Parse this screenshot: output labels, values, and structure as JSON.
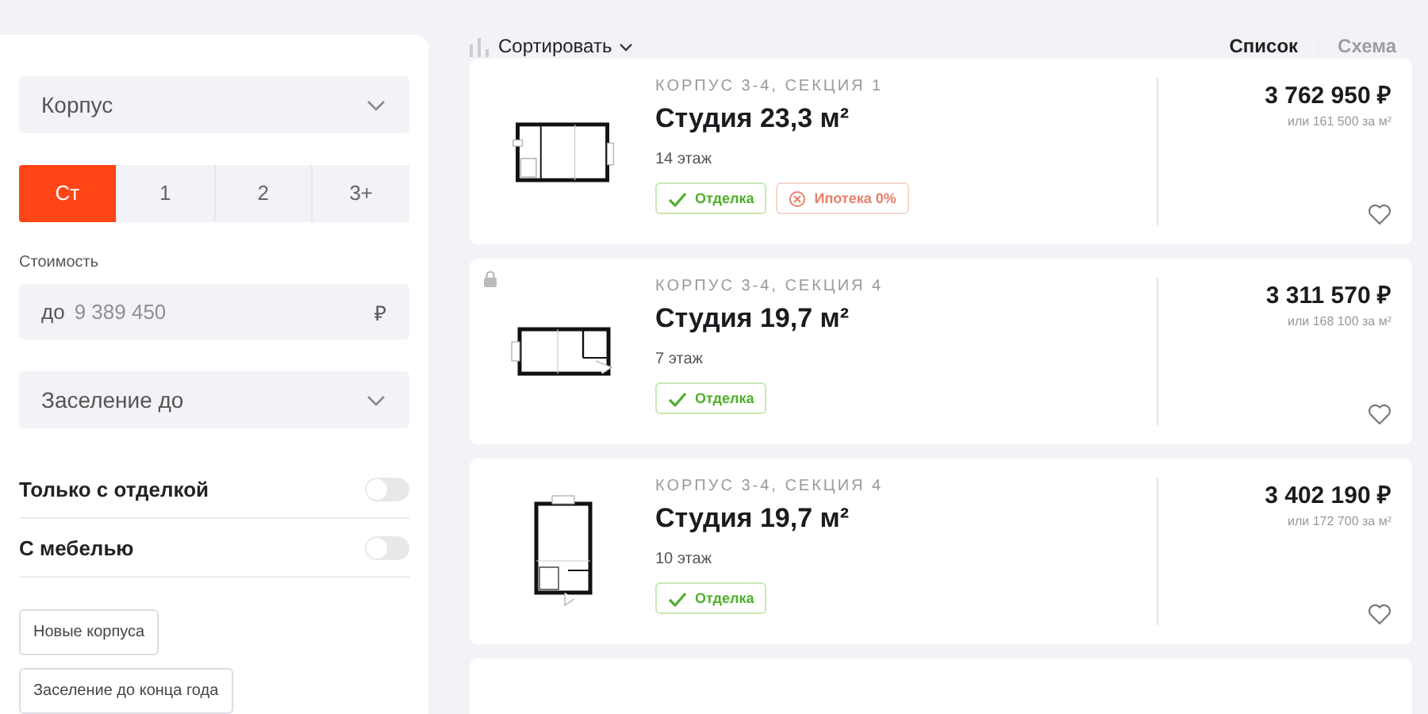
{
  "sidebar": {
    "building_select": {
      "placeholder": "Корпус"
    },
    "room_options": [
      {
        "label": "Ст",
        "selected": true
      },
      {
        "label": "1",
        "selected": false
      },
      {
        "label": "2",
        "selected": false
      },
      {
        "label": "3+",
        "selected": false
      }
    ],
    "price": {
      "label": "Стоимость",
      "prefix": "до",
      "placeholder": "9 389 450",
      "currency": "₽"
    },
    "move_in_select": {
      "placeholder": "Заселение до"
    },
    "toggles": [
      {
        "label": "Только с отделкой",
        "on": false
      },
      {
        "label": "С мебелью",
        "on": false
      }
    ],
    "chips": [
      "Новые корпуса",
      "Заселение до конца года"
    ]
  },
  "toolbar": {
    "sort": "Сортировать",
    "views": [
      {
        "label": "Список",
        "selected": true
      },
      {
        "label": "Схема",
        "selected": false
      }
    ]
  },
  "listings": [
    {
      "building": "КОРПУС 3-4, СЕКЦИЯ 1",
      "title": "Студия 23,3 м²",
      "floor": "14 этаж",
      "tags": [
        {
          "kind": "finish",
          "label": "Отделка"
        },
        {
          "kind": "mortgage",
          "label": "Ипотека 0%"
        }
      ],
      "price": "3 762 950 ₽",
      "price_per_m2": "или 161 500 за м²",
      "locked": false,
      "favorite": false
    },
    {
      "building": "КОРПУС 3-4, СЕКЦИЯ 4",
      "title": "Студия 19,7 м²",
      "floor": "7 этаж",
      "tags": [
        {
          "kind": "finish",
          "label": "Отделка"
        }
      ],
      "price": "3 311 570 ₽",
      "price_per_m2": "или 168 100 за м²",
      "locked": true,
      "favorite": false
    },
    {
      "building": "КОРПУС 3-4, СЕКЦИЯ 4",
      "title": "Студия 19,7 м²",
      "floor": "10 этаж",
      "tags": [
        {
          "kind": "finish",
          "label": "Отделка"
        }
      ],
      "price": "3 402 190 ₽",
      "price_per_m2": "или 172 700 за м²",
      "locked": false,
      "favorite": false
    }
  ]
}
